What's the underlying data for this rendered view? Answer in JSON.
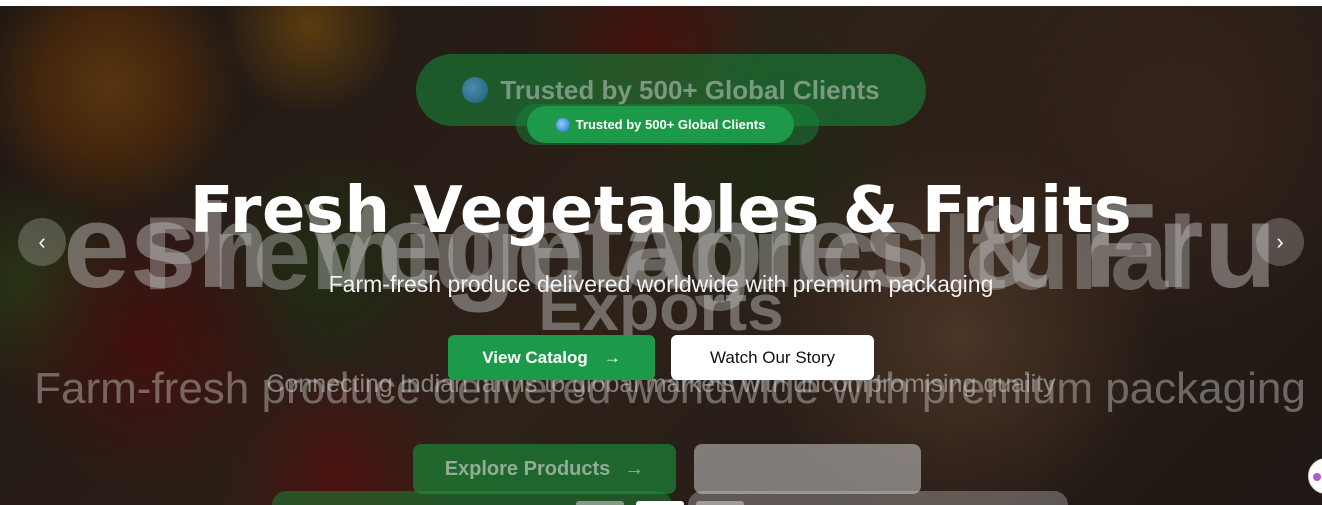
{
  "hero": {
    "badge_text": "Trusted by 500+ Global Clients",
    "title": "Fresh Vegetables & Fruits",
    "subtitle": "Farm-fresh produce delivered worldwide with premium packaging",
    "primary_button": "View Catalog",
    "secondary_button": "Watch Our Story"
  },
  "next_slide": {
    "badge_text": "Trusted by 500+ Global Clients",
    "title_line1": "Premium Agricultural",
    "title_line2": "Exports",
    "tagline": "Connecting Indian farms to global markets with uncompromising quality",
    "primary_button": "Explore Products"
  },
  "prev_slide": {
    "title": "Fresh Vegetables & Fruits",
    "subtitle": "Farm-fresh produce delivered worldwide with premium packaging"
  },
  "icons": {
    "badge": "globe-icon",
    "primary_button": "arrow-right-icon",
    "prev": "chevron-left-icon",
    "next": "chevron-right-icon"
  },
  "carousel": {
    "slide_count": 3,
    "active_index": 1
  },
  "colors": {
    "accent": "#1d9a49",
    "overlay": "#0a0a0a"
  }
}
